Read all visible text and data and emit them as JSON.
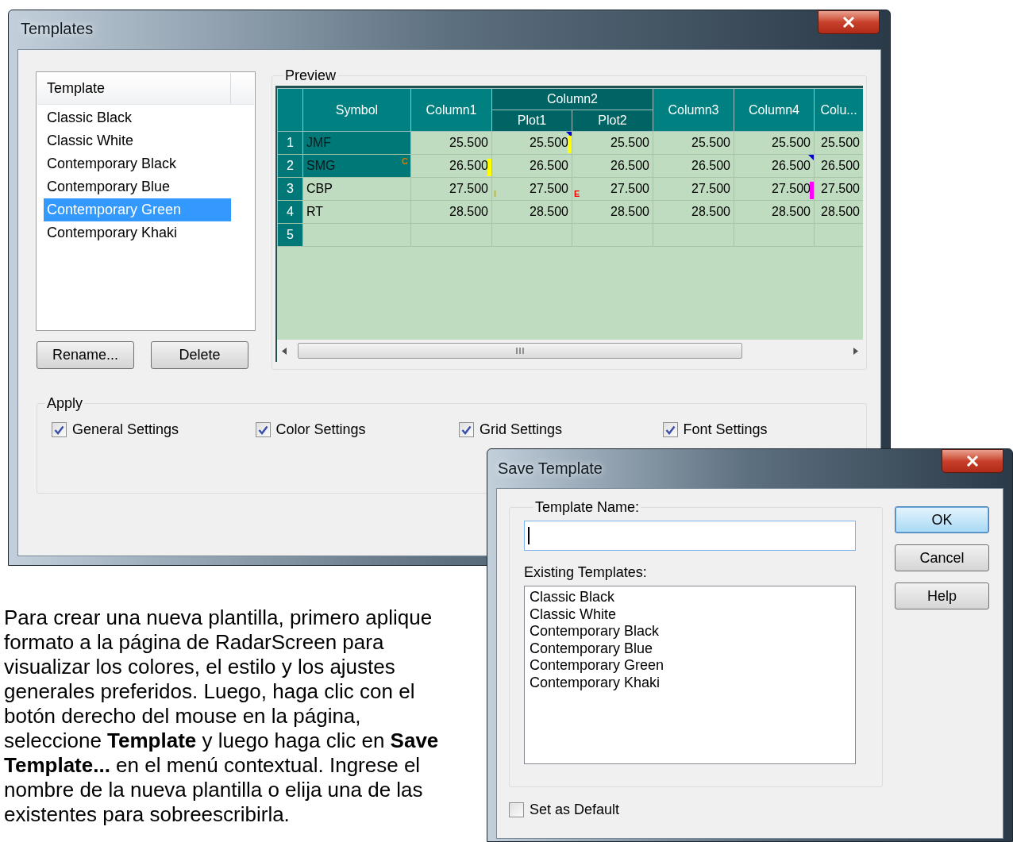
{
  "templates_window": {
    "title": "Templates",
    "list": {
      "header": "Template",
      "items": [
        {
          "label": "Classic Black",
          "selected": false
        },
        {
          "label": "Classic White",
          "selected": false
        },
        {
          "label": "Contemporary Black",
          "selected": false
        },
        {
          "label": "Contemporary Blue",
          "selected": false
        },
        {
          "label": "Contemporary Green",
          "selected": true
        },
        {
          "label": "Contemporary Khaki",
          "selected": false
        }
      ]
    },
    "buttons": [
      "Rename...",
      "Delete"
    ],
    "preview": {
      "label": "Preview",
      "columns": [
        {
          "label": "Symbol"
        },
        {
          "label": "Column1"
        },
        {
          "label": "Column2",
          "children": [
            "Plot1",
            "Plot2"
          ]
        },
        {
          "label": "Column3"
        },
        {
          "label": "Column4"
        },
        {
          "label": "Colu..."
        }
      ],
      "rows": [
        {
          "number": "1",
          "highlighted": true,
          "cells": [
            {
              "text": "JMF"
            },
            {
              "text": "25.500"
            },
            {
              "text": "25.500",
              "markers": [
                {
                  "kind": "corner",
                  "color": "#0000cc"
                },
                {
                  "kind": "bar",
                  "color": "#ffff00"
                }
              ]
            },
            {
              "text": "25.500"
            },
            {
              "text": "25.500"
            },
            {
              "text": "25.500"
            },
            {
              "text": "25.500"
            }
          ]
        },
        {
          "number": "2",
          "highlighted": true,
          "cells": [
            {
              "text": "SMG",
              "markers": [
                {
                  "kind": "superscript",
                  "text": "C",
                  "color": "#e07800"
                }
              ]
            },
            {
              "text": "26.500",
              "markers": [
                {
                  "kind": "bar",
                  "color": "#ffff00"
                }
              ]
            },
            {
              "text": "26.500"
            },
            {
              "text": "26.500"
            },
            {
              "text": "26.500"
            },
            {
              "text": "26.500",
              "markers": [
                {
                  "kind": "corner",
                  "color": "#0000cc"
                }
              ]
            },
            {
              "text": "26.500"
            }
          ]
        },
        {
          "number": "3",
          "highlighted": false,
          "cells": [
            {
              "text": "CBP"
            },
            {
              "text": "27.500"
            },
            {
              "text": "27.500",
              "markers": [
                {
                  "kind": "subscript",
                  "text": "I",
                  "color": "#c8b400"
                }
              ]
            },
            {
              "text": "27.500",
              "markers": [
                {
                  "kind": "subscript",
                  "text": "E",
                  "color": "#ff0000"
                }
              ]
            },
            {
              "text": "27.500"
            },
            {
              "text": "27.500",
              "markers": [
                {
                  "kind": "bar",
                  "color": "#ff00ff"
                }
              ]
            },
            {
              "text": "27.500"
            }
          ]
        },
        {
          "number": "4",
          "highlighted": false,
          "cells": [
            {
              "text": "RT"
            },
            {
              "text": "28.500"
            },
            {
              "text": "28.500"
            },
            {
              "text": "28.500"
            },
            {
              "text": "28.500"
            },
            {
              "text": "28.500"
            },
            {
              "text": "28.500"
            }
          ]
        },
        {
          "number": "5",
          "highlighted": false
        }
      ]
    },
    "apply": {
      "label": "Apply",
      "options": [
        {
          "label": "General Settings",
          "checked": true
        },
        {
          "label": "Color Settings",
          "checked": true
        },
        {
          "label": "Grid Settings",
          "checked": true
        },
        {
          "label": "Font Settings",
          "checked": true
        }
      ]
    }
  },
  "save_window": {
    "title": "Save Template",
    "name_label": "Template Name:",
    "existing_label": "Existing Templates:",
    "existing": [
      "Classic Black",
      "Classic White",
      "Contemporary Black",
      "Contemporary Blue",
      "Contemporary Green",
      "Contemporary Khaki"
    ],
    "buttons": [
      {
        "label": "OK",
        "default": true
      },
      {
        "label": "Cancel",
        "default": false
      },
      {
        "label": "Help",
        "default": false
      }
    ],
    "set_default": {
      "label": "Set as Default",
      "checked": false
    }
  },
  "paragraph": "Para crear una nueva plantilla, primero aplique formato a la página de RadarScreen para visualizar los colores, el estilo y los ajustes generales preferidos. Luego, haga clic con el botón derecho del mouse en la página, seleccione **Template** y luego haga clic en **Save Template...** en el menú contextual. Ingrese el nombre de la nueva plantilla o elija una de las existentes para sobreescribirla."
}
